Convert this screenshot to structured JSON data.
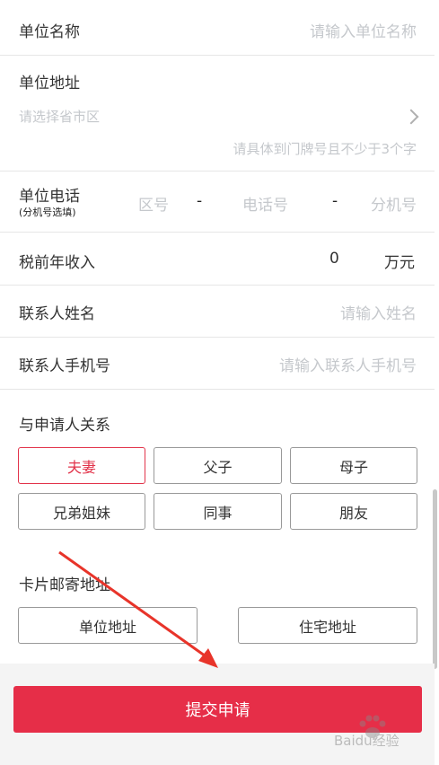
{
  "unit_name": {
    "label": "单位名称",
    "placeholder": "请输入单位名称"
  },
  "unit_address": {
    "label": "单位地址",
    "region_placeholder": "请选择省市区",
    "detail_placeholder": "请具体到门牌号且不少于3个字"
  },
  "unit_phone": {
    "label": "单位电话",
    "sublabel": "(分机号选填)",
    "area_placeholder": "区号",
    "sep1": "-",
    "phone_placeholder": "电话号",
    "sep2": "-",
    "ext_placeholder": "分机号"
  },
  "income": {
    "label": "税前年收入",
    "value": "0",
    "unit": "万元"
  },
  "contact_name": {
    "label": "联系人姓名",
    "placeholder": "请输入姓名"
  },
  "contact_phone": {
    "label": "联系人手机号",
    "placeholder": "请输入联系人手机号"
  },
  "relation": {
    "title": "与申请人关系",
    "options": [
      "夫妻",
      "父子",
      "母子",
      "兄弟姐妹",
      "同事",
      "朋友"
    ],
    "selected": "夫妻"
  },
  "mail": {
    "title": "卡片邮寄地址",
    "options": [
      "单位地址",
      "住宅地址"
    ]
  },
  "submit_label": "提交申请",
  "colors": {
    "accent": "#e62e48",
    "placeholder": "#c5c8cc",
    "annotation_arrow": "#e8342a"
  },
  "watermark": "Baidu经验"
}
